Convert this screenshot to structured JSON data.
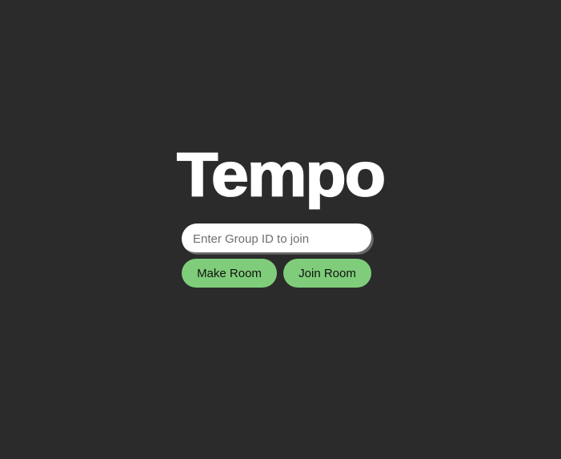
{
  "app": {
    "logo_text": "Tempo"
  },
  "join_form": {
    "group_id_placeholder": "Enter Group ID to join",
    "group_id_value": "",
    "make_room_label": "Make Room",
    "join_room_label": "Join Room"
  },
  "colors": {
    "background": "#2b2b2b",
    "logo": "#ffffff",
    "button_bg": "#7fcd7a",
    "button_text": "#111111"
  }
}
